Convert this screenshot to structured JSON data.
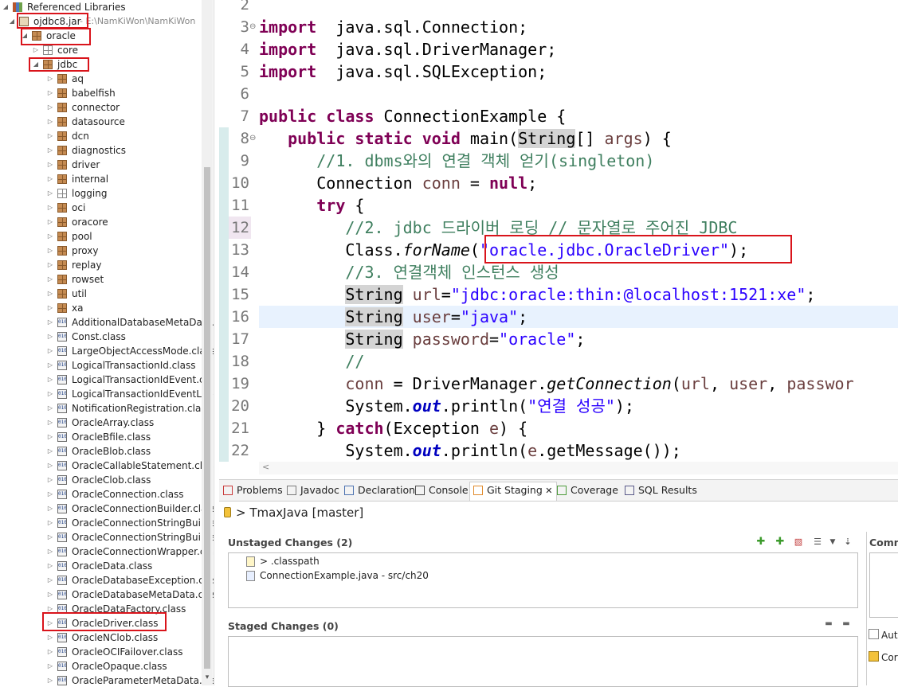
{
  "tree": {
    "items": [
      {
        "depth": 0,
        "arrow": "open",
        "icon": "library-icon",
        "label": "Referenced Libraries"
      },
      {
        "depth": 1,
        "arrow": "open",
        "icon": "jar-icon",
        "label": "ojdbc8.jar",
        "suffix": " - E:\\NamKiWon\\NamKiWon"
      },
      {
        "depth": 2,
        "arrow": "open",
        "icon": "package-icon",
        "label": "oracle"
      },
      {
        "depth": 3,
        "arrow": "closed",
        "icon": "package-empty-icon",
        "label": "core"
      },
      {
        "depth": 3,
        "arrow": "open",
        "icon": "package-icon",
        "label": "jdbc"
      },
      {
        "depth": 4,
        "arrow": "closed",
        "icon": "package-icon",
        "label": "aq"
      },
      {
        "depth": 4,
        "arrow": "closed",
        "icon": "package-icon",
        "label": "babelfish"
      },
      {
        "depth": 4,
        "arrow": "closed",
        "icon": "package-icon",
        "label": "connector"
      },
      {
        "depth": 4,
        "arrow": "closed",
        "icon": "package-icon",
        "label": "datasource"
      },
      {
        "depth": 4,
        "arrow": "closed",
        "icon": "package-icon",
        "label": "dcn"
      },
      {
        "depth": 4,
        "arrow": "closed",
        "icon": "package-icon",
        "label": "diagnostics"
      },
      {
        "depth": 4,
        "arrow": "closed",
        "icon": "package-icon",
        "label": "driver"
      },
      {
        "depth": 4,
        "arrow": "closed",
        "icon": "package-icon",
        "label": "internal"
      },
      {
        "depth": 4,
        "arrow": "closed",
        "icon": "package-empty-icon",
        "label": "logging"
      },
      {
        "depth": 4,
        "arrow": "closed",
        "icon": "package-icon",
        "label": "oci"
      },
      {
        "depth": 4,
        "arrow": "closed",
        "icon": "package-icon",
        "label": "oracore"
      },
      {
        "depth": 4,
        "arrow": "closed",
        "icon": "package-icon",
        "label": "pool"
      },
      {
        "depth": 4,
        "arrow": "closed",
        "icon": "package-icon",
        "label": "proxy"
      },
      {
        "depth": 4,
        "arrow": "closed",
        "icon": "package-icon",
        "label": "replay"
      },
      {
        "depth": 4,
        "arrow": "closed",
        "icon": "package-icon",
        "label": "rowset"
      },
      {
        "depth": 4,
        "arrow": "closed",
        "icon": "package-icon",
        "label": "util"
      },
      {
        "depth": 4,
        "arrow": "closed",
        "icon": "package-icon",
        "label": "xa"
      },
      {
        "depth": 4,
        "arrow": "closed",
        "icon": "class-file-icon",
        "label": "AdditionalDatabaseMetaData."
      },
      {
        "depth": 4,
        "arrow": "closed",
        "icon": "class-file-icon",
        "label": "Const.class"
      },
      {
        "depth": 4,
        "arrow": "closed",
        "icon": "class-file-icon",
        "label": "LargeObjectAccessMode.class"
      },
      {
        "depth": 4,
        "arrow": "closed",
        "icon": "class-file-icon",
        "label": "LogicalTransactionId.class"
      },
      {
        "depth": 4,
        "arrow": "closed",
        "icon": "class-file-icon",
        "label": "LogicalTransactionIdEvent.clas"
      },
      {
        "depth": 4,
        "arrow": "closed",
        "icon": "class-file-icon",
        "label": "LogicalTransactionIdEventListe"
      },
      {
        "depth": 4,
        "arrow": "closed",
        "icon": "class-file-icon",
        "label": "NotificationRegistration.class"
      },
      {
        "depth": 4,
        "arrow": "closed",
        "icon": "class-file-icon",
        "label": "OracleArray.class"
      },
      {
        "depth": 4,
        "arrow": "closed",
        "icon": "class-file-icon",
        "label": "OracleBfile.class"
      },
      {
        "depth": 4,
        "arrow": "closed",
        "icon": "class-file-icon",
        "label": "OracleBlob.class"
      },
      {
        "depth": 4,
        "arrow": "closed",
        "icon": "class-file-icon",
        "label": "OracleCallableStatement.class"
      },
      {
        "depth": 4,
        "arrow": "closed",
        "icon": "class-file-icon",
        "label": "OracleClob.class"
      },
      {
        "depth": 4,
        "arrow": "closed",
        "icon": "class-file-icon",
        "label": "OracleConnection.class"
      },
      {
        "depth": 4,
        "arrow": "closed",
        "icon": "class-file-icon",
        "label": "OracleConnectionBuilder.class"
      },
      {
        "depth": 4,
        "arrow": "closed",
        "icon": "class-file-icon",
        "label": "OracleConnectionStringBuilde"
      },
      {
        "depth": 4,
        "arrow": "closed",
        "icon": "class-file-icon",
        "label": "OracleConnectionStringBuilde"
      },
      {
        "depth": 4,
        "arrow": "closed",
        "icon": "class-file-icon",
        "label": "OracleConnectionWrapper.cla"
      },
      {
        "depth": 4,
        "arrow": "closed",
        "icon": "class-file-icon",
        "label": "OracleData.class"
      },
      {
        "depth": 4,
        "arrow": "closed",
        "icon": "class-file-icon",
        "label": "OracleDatabaseException.class"
      },
      {
        "depth": 4,
        "arrow": "closed",
        "icon": "class-file-icon",
        "label": "OracleDatabaseMetaData.class"
      },
      {
        "depth": 4,
        "arrow": "closed",
        "icon": "class-file-icon",
        "label": "OracleDataFactory.class"
      },
      {
        "depth": 4,
        "arrow": "closed",
        "icon": "class-file-icon",
        "label": "OracleDriver.class"
      },
      {
        "depth": 4,
        "arrow": "closed",
        "icon": "class-file-icon",
        "label": "OracleNClob.class"
      },
      {
        "depth": 4,
        "arrow": "closed",
        "icon": "class-file-icon",
        "label": "OracleOCIFailover.class"
      },
      {
        "depth": 4,
        "arrow": "closed",
        "icon": "class-file-icon",
        "label": "OracleOpaque.class"
      },
      {
        "depth": 4,
        "arrow": "closed",
        "icon": "class-file-icon",
        "label": "OracleParameterMetaData.clas"
      }
    ]
  },
  "editor": {
    "line_numbers": [
      "2",
      "3",
      "4",
      "5",
      "6",
      "7",
      "8",
      "9",
      "10",
      "11",
      "12",
      "13",
      "14",
      "15",
      "16",
      "17",
      "18",
      "19",
      "20",
      "21",
      "22"
    ],
    "lines": [
      [],
      [
        [
          "kw",
          "import"
        ],
        [
          "",
          "  java.sql.Connection;"
        ]
      ],
      [
        [
          "kw",
          "import"
        ],
        [
          "",
          "  java.sql.DriverManager;"
        ]
      ],
      [
        [
          "kw",
          "import"
        ],
        [
          "",
          "  java.sql.SQLException;"
        ]
      ],
      [],
      [
        [
          "kw",
          "public"
        ],
        [
          "",
          " "
        ],
        [
          "kw",
          "class"
        ],
        [
          "",
          " ConnectionExample {"
        ]
      ],
      [
        [
          "",
          "   "
        ],
        [
          "kw",
          "public"
        ],
        [
          "",
          " "
        ],
        [
          "kw",
          "static"
        ],
        [
          "",
          " "
        ],
        [
          "kw",
          "void"
        ],
        [
          "",
          " main("
        ],
        [
          "typebg",
          "String"
        ],
        [
          "",
          "[] "
        ],
        [
          "var",
          "args"
        ],
        [
          "",
          ") {"
        ]
      ],
      [
        [
          "",
          "      "
        ],
        [
          "cm",
          "//1. dbms와의 연결 객체 얻기(singleton)"
        ]
      ],
      [
        [
          "",
          "      Connection "
        ],
        [
          "var",
          "conn"
        ],
        [
          "",
          " = "
        ],
        [
          "kw",
          "null"
        ],
        [
          "",
          ";"
        ]
      ],
      [
        [
          "",
          "      "
        ],
        [
          "kw",
          "try"
        ],
        [
          "",
          " {"
        ]
      ],
      [
        [
          "",
          "         "
        ],
        [
          "cm",
          "//2. jdbc 드라이버 로딩 // 문자열로 주어진 JDBC"
        ]
      ],
      [
        [
          "",
          "         Class."
        ],
        [
          "it",
          "forName"
        ],
        [
          "",
          "("
        ],
        [
          "str",
          "\"oracle.jdbc.OracleDriver\""
        ],
        [
          "",
          ");"
        ]
      ],
      [
        [
          "",
          "         "
        ],
        [
          "cm",
          "//3. 연결객체 인스턴스 생성"
        ]
      ],
      [
        [
          "",
          "         "
        ],
        [
          "typebg",
          "String"
        ],
        [
          "",
          " "
        ],
        [
          "var",
          "url"
        ],
        [
          "",
          "="
        ],
        [
          "str",
          "\"jdbc:oracle:thin:@localhost:1521:xe\""
        ],
        [
          "",
          ";"
        ]
      ],
      [
        [
          "",
          "         "
        ],
        [
          "typebg",
          "String"
        ],
        [
          "",
          " "
        ],
        [
          "var",
          "user"
        ],
        [
          "",
          "="
        ],
        [
          "str",
          "\"java\""
        ],
        [
          "",
          ";"
        ]
      ],
      [
        [
          "",
          "         "
        ],
        [
          "typebg",
          "String"
        ],
        [
          "",
          " "
        ],
        [
          "var",
          "password"
        ],
        [
          "",
          "="
        ],
        [
          "str",
          "\"oracle\""
        ],
        [
          "",
          ";"
        ]
      ],
      [
        [
          "",
          "         "
        ],
        [
          "cm",
          "//"
        ]
      ],
      [
        [
          "",
          "         "
        ],
        [
          "var",
          "conn"
        ],
        [
          "",
          " = DriverManager."
        ],
        [
          "it",
          "getConnection"
        ],
        [
          "",
          "("
        ],
        [
          "var",
          "url"
        ],
        [
          "",
          ", "
        ],
        [
          "var",
          "user"
        ],
        [
          "",
          ", "
        ],
        [
          "var",
          "passwor"
        ]
      ],
      [
        [
          "",
          "         System."
        ],
        [
          "fld",
          "out"
        ],
        [
          "",
          ".println("
        ],
        [
          "str",
          "\"연결 성공\""
        ],
        [
          "",
          ");"
        ]
      ],
      [
        [
          "",
          "      } "
        ],
        [
          "kw",
          "catch"
        ],
        [
          "",
          "(Exception "
        ],
        [
          "var",
          "e"
        ],
        [
          "",
          ") {"
        ]
      ],
      [
        [
          "",
          "         System."
        ],
        [
          "fld",
          "out"
        ],
        [
          "",
          ".println("
        ],
        [
          "var",
          "e"
        ],
        [
          "",
          ".getMessage());"
        ]
      ]
    ],
    "fold_markers": [
      "⊖",
      "⊖"
    ]
  },
  "bottom": {
    "tabs": [
      {
        "label": "Problems",
        "icon": "problems-icon"
      },
      {
        "label": "Javadoc",
        "icon": "javadoc-icon"
      },
      {
        "label": "Declaration",
        "icon": "declaration-icon"
      },
      {
        "label": "Console",
        "icon": "console-icon"
      },
      {
        "label": "Git Staging",
        "icon": "git-staging-icon",
        "active": true
      },
      {
        "label": "Coverage",
        "icon": "coverage-icon"
      },
      {
        "label": "SQL Results",
        "icon": "sql-results-icon"
      }
    ],
    "repo_label": "> TmaxJava [master]",
    "unstaged_title": "Unstaged Changes (2)",
    "unstaged_files": [
      "> .classpath",
      "ConnectionExample.java - src/ch20"
    ],
    "staged_title": "Staged Changes (0)",
    "commit_label": "Comm",
    "auto_label": "Aut",
    "con_label": "Cor"
  },
  "colors": {
    "keyword": "#7f0055",
    "string": "#2a00ff",
    "comment": "#3f7f5f",
    "highlight_box": "#d9141b"
  }
}
